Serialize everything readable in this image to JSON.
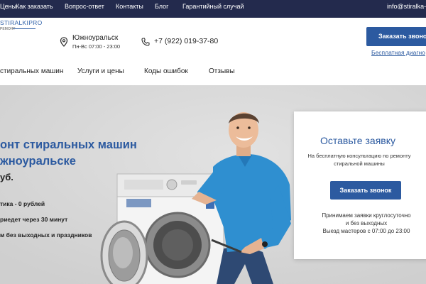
{
  "topbar": {
    "links": [
      "Цены",
      "Как заказать",
      "Вопрос-ответ",
      "Контакты",
      "Блог",
      "Гарантийный случай"
    ],
    "email": "info@stiralka-p"
  },
  "header": {
    "logo_main": "STIRALKIPRO",
    "logo_sub": "РЕМОНТ",
    "city": "Южноуральск",
    "hours": "Пн-Вс 07:00 - 23:00",
    "phone": "+7 (922) 019-37-80",
    "call_button": "Заказать звонок",
    "diag_link": "Бесплатная диагно"
  },
  "menu": {
    "items": [
      "стиральных машин",
      "Услуги и цены",
      "Коды ошибок",
      "Отзывы"
    ]
  },
  "hero": {
    "title_line1": "онт стиральных машин",
    "title_line2": "жноуральске",
    "price": "уб.",
    "features": [
      "тика - 0 рублей",
      "риедет через 30 минут",
      "м без выходных и праздников"
    ]
  },
  "request_card": {
    "title": "Оставьте заявку",
    "subtitle": "На бесплатную консультацию по ремонту стиральной машины",
    "button": "Заказать звонок",
    "info_line1": "Принимаем заявки круглосуточно",
    "info_line2": "и без выходных",
    "info_line3": "Выезд мастеров с 07:00 до 23:00"
  },
  "colors": {
    "topbar": "#232a4d",
    "accent": "#2c5aa0",
    "hero_bg": "#d6d6d6"
  }
}
